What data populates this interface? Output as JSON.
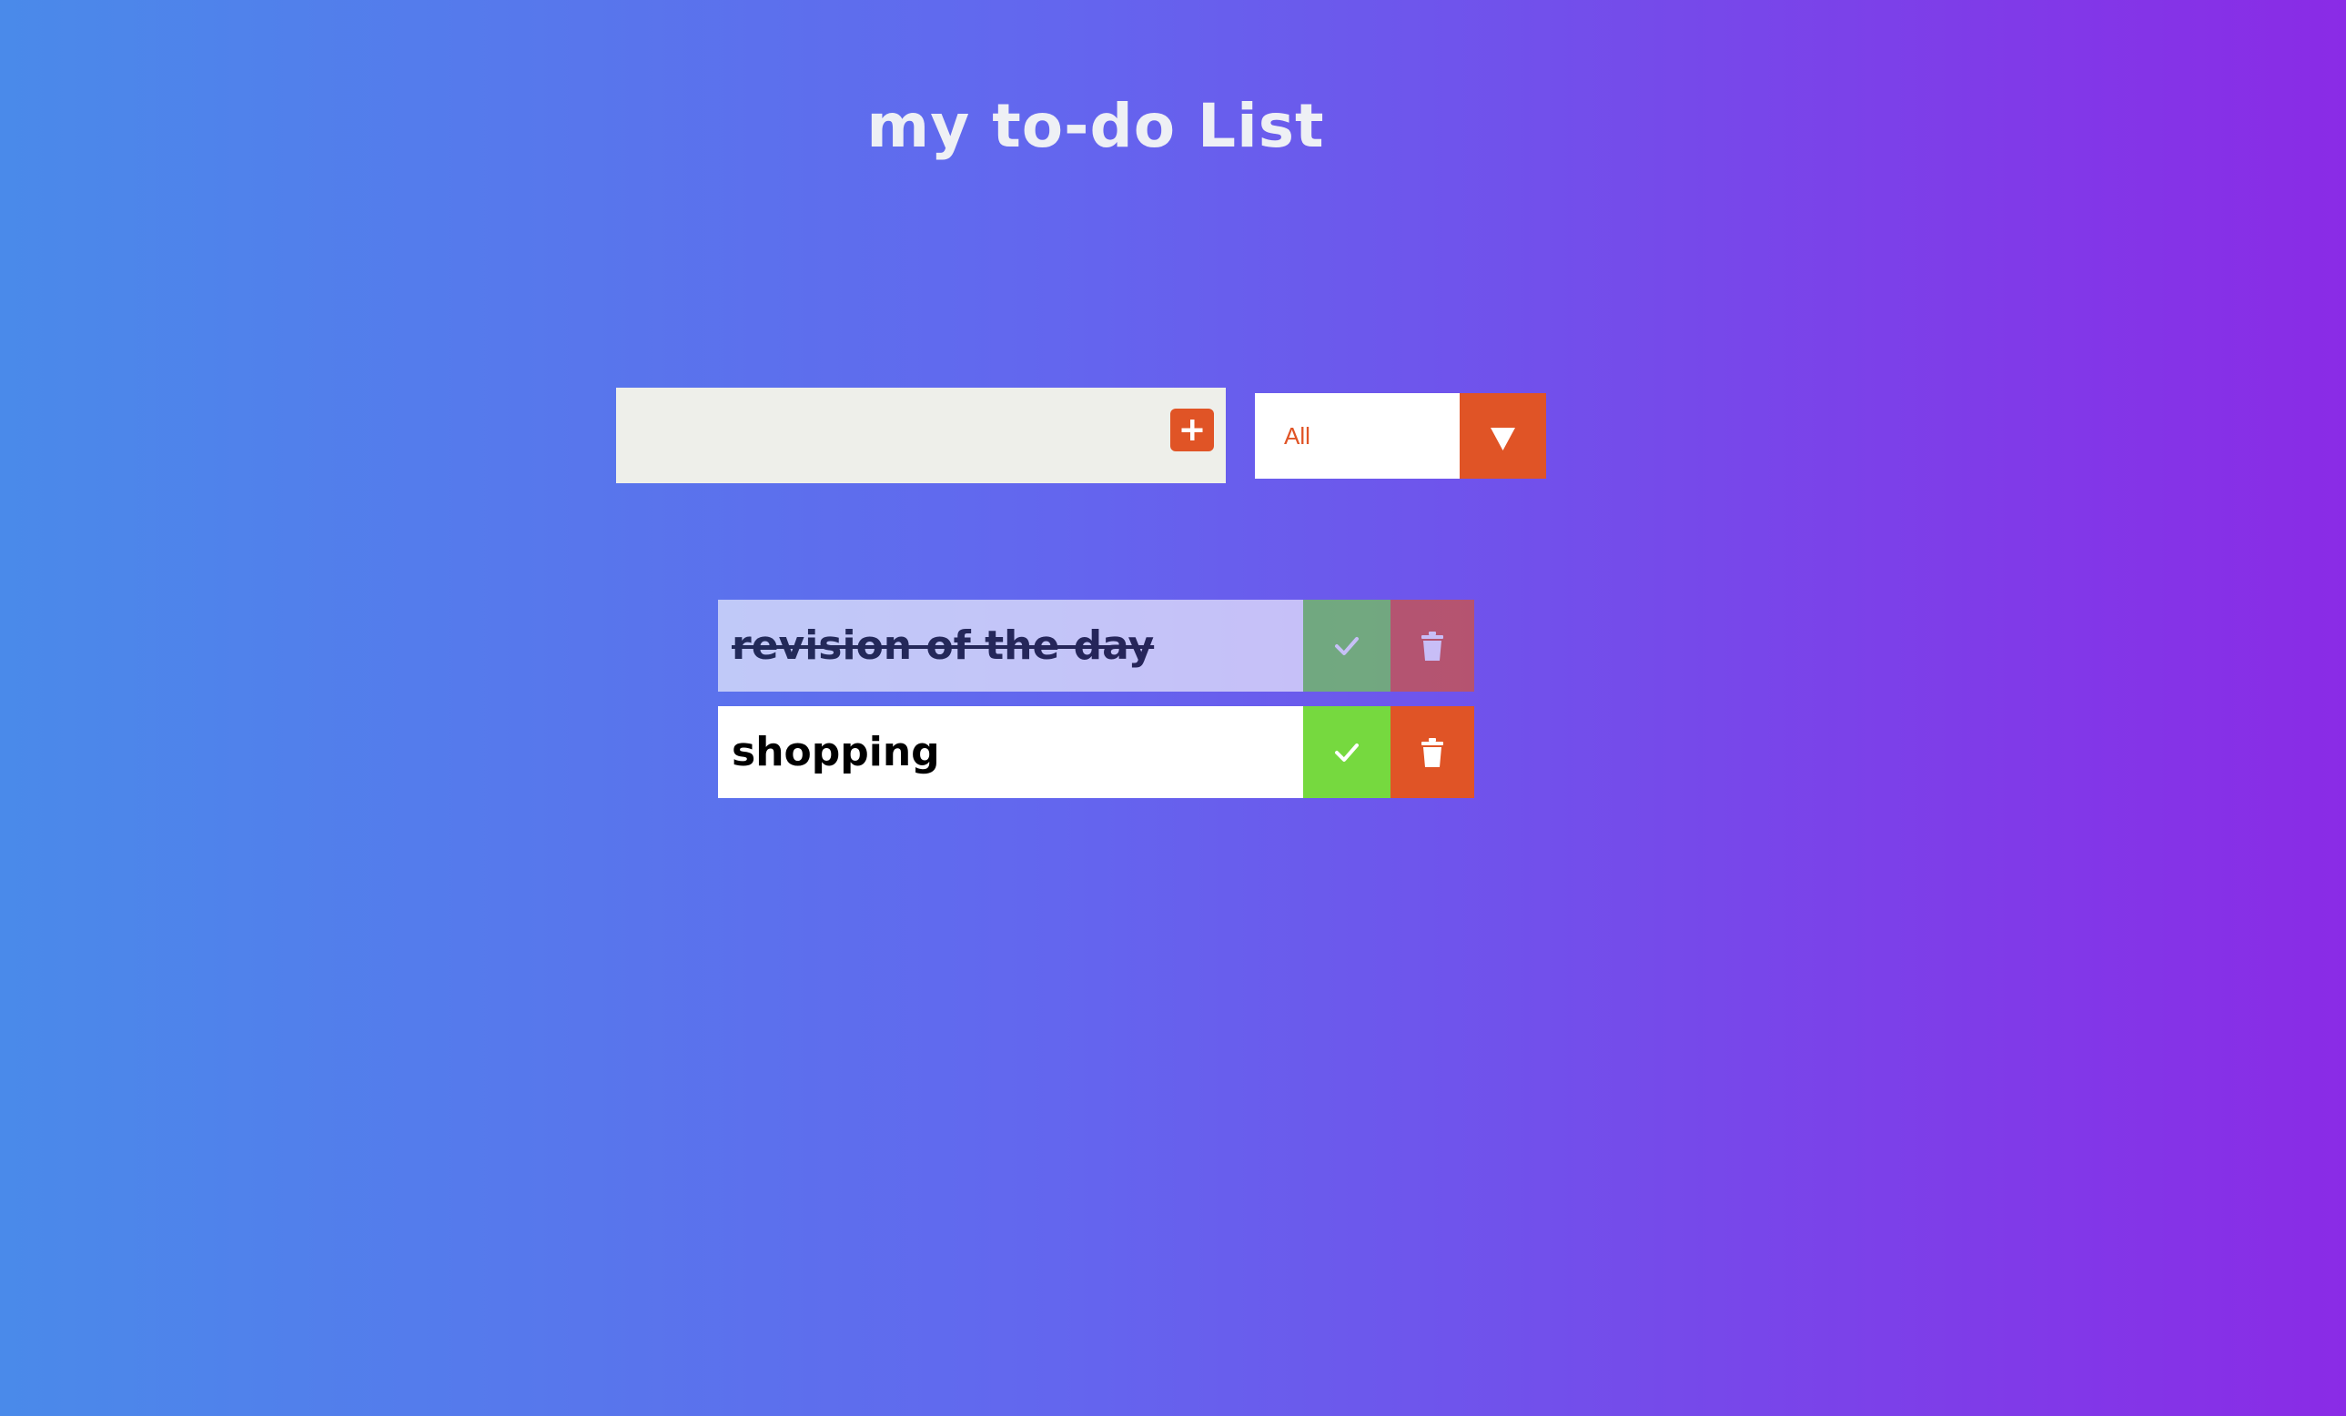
{
  "header": {
    "title": "my to-do List"
  },
  "add_form": {
    "input_value": "",
    "placeholder": "",
    "add_icon": "plus-icon"
  },
  "filter": {
    "selected": "All",
    "arrow_icon": "caret-down-icon"
  },
  "todos": [
    {
      "text": "revision of the day",
      "completed": true,
      "check_icon": "check-icon",
      "delete_icon": "trash-icon"
    },
    {
      "text": "shopping",
      "completed": false,
      "check_icon": "check-icon",
      "delete_icon": "trash-icon"
    }
  ],
  "colors": {
    "accent": "#e05426",
    "complete_button": "#76d93f",
    "gradient_start": "#4a8aea",
    "gradient_end": "#8a2be6",
    "input_background": "#eeefea"
  }
}
